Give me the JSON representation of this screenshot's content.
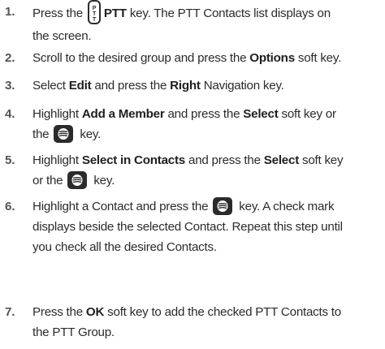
{
  "steps": [
    {
      "number": "1.",
      "t1": "Press the",
      "t2": "PTT",
      "t3": "key. The PTT Contacts list displays on",
      "t4": "the screen.",
      "icons": [
        "ptt-key-icon"
      ]
    },
    {
      "number": "2.",
      "t1": "Scroll to the desired group and press the",
      "t2": "Options",
      "t3": "soft key."
    },
    {
      "number": "3.",
      "t1": "Select",
      "t2": "Edit",
      "t3": "and press the",
      "t4": "Right",
      "t5": "Navigation key."
    },
    {
      "number": "4.",
      "t1": "Highlight",
      "t2": "Add a Member",
      "t3": "and press the",
      "t4": "Select",
      "t5": "soft key or",
      "t6": "the",
      "t7": "key.",
      "icons": [
        "select-key-icon"
      ]
    },
    {
      "number": "5.",
      "t1": "Highlight",
      "t2": "Select in Contacts",
      "t3": "and press the",
      "t4": "Select",
      "t5": "soft key",
      "t6": "or the",
      "t7": "key.",
      "icons": [
        "select-key-icon"
      ]
    },
    {
      "number": "6.",
      "t1": "Highlight a Contact and press the",
      "t2": "key. A check mark",
      "t3": "displays beside the selected Contact. Repeat this step until",
      "t4": "you check all the desired Contacts.",
      "icons": [
        "select-key-icon"
      ]
    },
    {
      "number": "7.",
      "t1": "Press the",
      "t2": "OK",
      "t3": "soft key to add the checked PTT Contacts to",
      "t4": "the PTT Group."
    }
  ]
}
